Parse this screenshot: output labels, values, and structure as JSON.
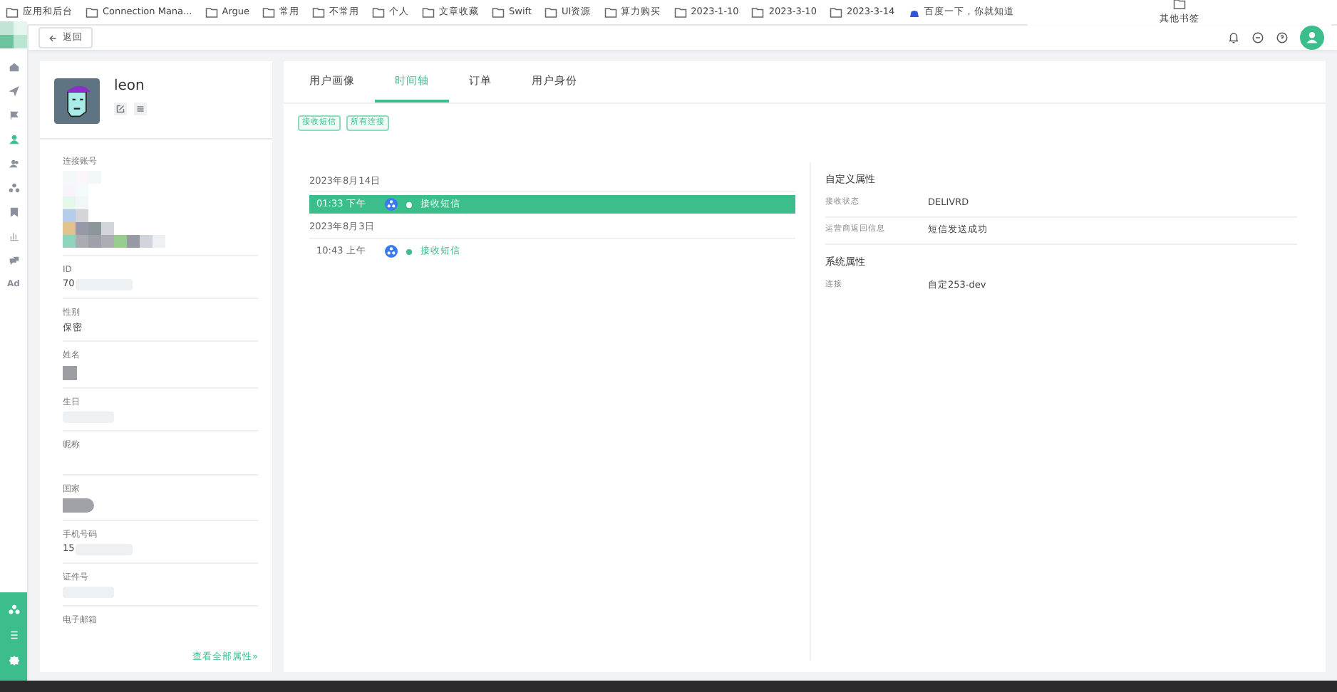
{
  "bookmarks": [
    {
      "label": "应用和后台",
      "kind": "folder"
    },
    {
      "label": "Connection Mana...",
      "kind": "folder"
    },
    {
      "label": "Argue",
      "kind": "folder"
    },
    {
      "label": "常用",
      "kind": "folder"
    },
    {
      "label": "不常用",
      "kind": "folder"
    },
    {
      "label": "个人",
      "kind": "folder"
    },
    {
      "label": "文章收藏",
      "kind": "folder"
    },
    {
      "label": "Swift",
      "kind": "folder"
    },
    {
      "label": "UI资源",
      "kind": "folder"
    },
    {
      "label": "算力购买",
      "kind": "folder"
    },
    {
      "label": "2023-1-10",
      "kind": "folder"
    },
    {
      "label": "2023-3-10",
      "kind": "folder"
    },
    {
      "label": "2023-3-14",
      "kind": "folder"
    },
    {
      "label": "百度一下，你就知道",
      "kind": "site"
    }
  ],
  "other_bookmarks": "其他书签",
  "rail": {
    "items": [
      {
        "kind": "icon",
        "selected": false
      },
      {
        "kind": "icon",
        "selected": false
      },
      {
        "kind": "icon",
        "selected": false
      },
      {
        "kind": "icon",
        "selected": true
      },
      {
        "kind": "icon",
        "selected": false
      },
      {
        "kind": "icon",
        "selected": false
      },
      {
        "kind": "icon",
        "selected": false
      },
      {
        "kind": "icon",
        "selected": false
      },
      {
        "kind": "icon",
        "selected": false
      },
      {
        "kind": "text",
        "label": "Ad",
        "selected": false
      }
    ]
  },
  "back_button": "返回",
  "profile": {
    "name": "leon",
    "fields": [
      {
        "label": "连接账号",
        "kind": "mosaic"
      },
      {
        "label": "ID",
        "value": "70",
        "kind": "partial"
      },
      {
        "label": "性别",
        "value": "保密",
        "kind": "text"
      },
      {
        "label": "姓名",
        "kind": "block"
      },
      {
        "label": "生日",
        "kind": "blur"
      },
      {
        "label": "昵称",
        "kind": "empty"
      },
      {
        "label": "国家",
        "kind": "pill"
      },
      {
        "label": "手机号码",
        "value": "15",
        "kind": "partial"
      },
      {
        "label": "证件号",
        "kind": "blur"
      },
      {
        "label": "电子邮箱",
        "kind": "empty"
      }
    ],
    "more_link": "查看全部属性»"
  },
  "tabs": [
    {
      "label": "用户画像",
      "selected": false
    },
    {
      "label": "时间轴",
      "selected": true
    },
    {
      "label": "订单",
      "selected": false
    },
    {
      "label": "用户身份",
      "selected": false
    }
  ],
  "filters": [
    "接收短信",
    "所有连接"
  ],
  "timeline": [
    {
      "date": "2023年8月14日",
      "events": [
        {
          "time": "01:33 下午",
          "event": "接收短信",
          "selected": true
        }
      ]
    },
    {
      "date": "2023年8月3日",
      "events": [
        {
          "time": "10:43 上午",
          "event": "接收短信",
          "selected": false
        }
      ]
    }
  ],
  "details": {
    "sections": [
      {
        "title": "自定义属性",
        "rows": [
          {
            "key": "接收状态",
            "value": "DELIVRD"
          },
          {
            "key": "运营商返回信息",
            "value": "短信发送成功"
          }
        ]
      },
      {
        "title": "系统属性",
        "rows": [
          {
            "key": "连接",
            "value": "自定253-dev"
          }
        ]
      }
    ]
  }
}
